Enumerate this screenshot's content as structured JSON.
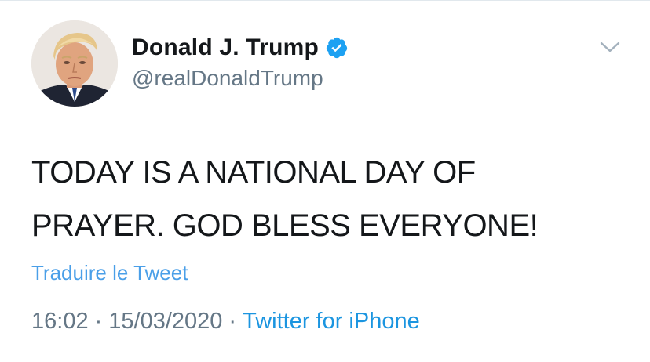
{
  "tweet": {
    "author": {
      "display_name": "Donald J. Trump",
      "handle": "@realDonaldTrump",
      "verified": true
    },
    "text_lines": [
      "TODAY IS A NATIONAL DAY OF",
      "PRAYER. GOD BLESS EVERYONE!"
    ],
    "translate_label": "Traduire le Tweet",
    "time": "16:02",
    "separator": "·",
    "date": "15/03/2020",
    "source": "Twitter for iPhone"
  },
  "icons": {
    "verified": "verified-badge-icon",
    "menu": "chevron-down-icon"
  },
  "colors": {
    "link": "#1b95e0",
    "translate": "#4a9fe8",
    "secondary_text": "#657786",
    "primary_text": "#14171a",
    "divider": "#e1e8ed"
  }
}
